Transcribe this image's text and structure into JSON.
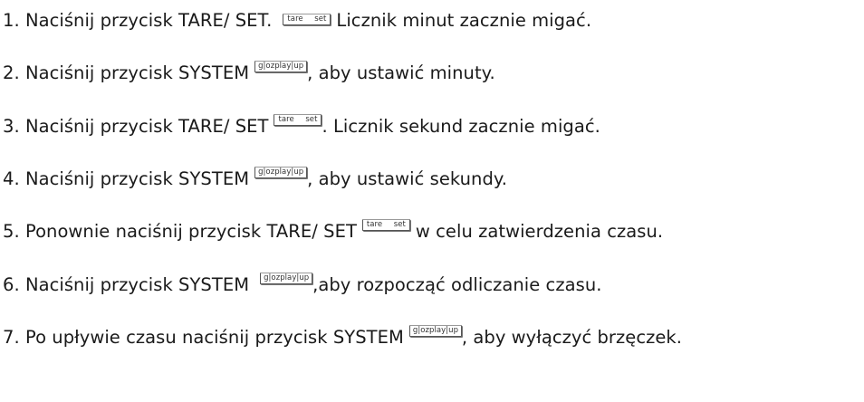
{
  "keys": {
    "tare": {
      "left": "tare",
      "right": "set"
    },
    "system": {
      "left": "g|oz",
      "right": "play|up"
    }
  },
  "steps": [
    {
      "before": "1. Naciśnij przycisk TARE/ SET.",
      "after": "Licznik minut zacznie migać."
    },
    {
      "before": "2. Naciśnij przycisk SYSTEM",
      "after": ", aby ustawić minuty."
    },
    {
      "before": "3. Naciśnij przycisk TARE/ SET",
      "after": ". Licznik sekund zacznie migać."
    },
    {
      "before": "4. Naciśnij przycisk SYSTEM",
      "after": ", aby ustawić sekundy."
    },
    {
      "before": "5. Ponownie naciśnij przycisk TARE/ SET",
      "after": "w celu zatwierdzenia czasu."
    },
    {
      "before": "6. Naciśnij przycisk SYSTEM",
      "after": ",aby rozpocząć odliczanie czasu."
    },
    {
      "before": "7. Po upływie czasu naciśnij przycisk SYSTEM",
      "after": ", aby wyłączyć brzęczek."
    }
  ]
}
